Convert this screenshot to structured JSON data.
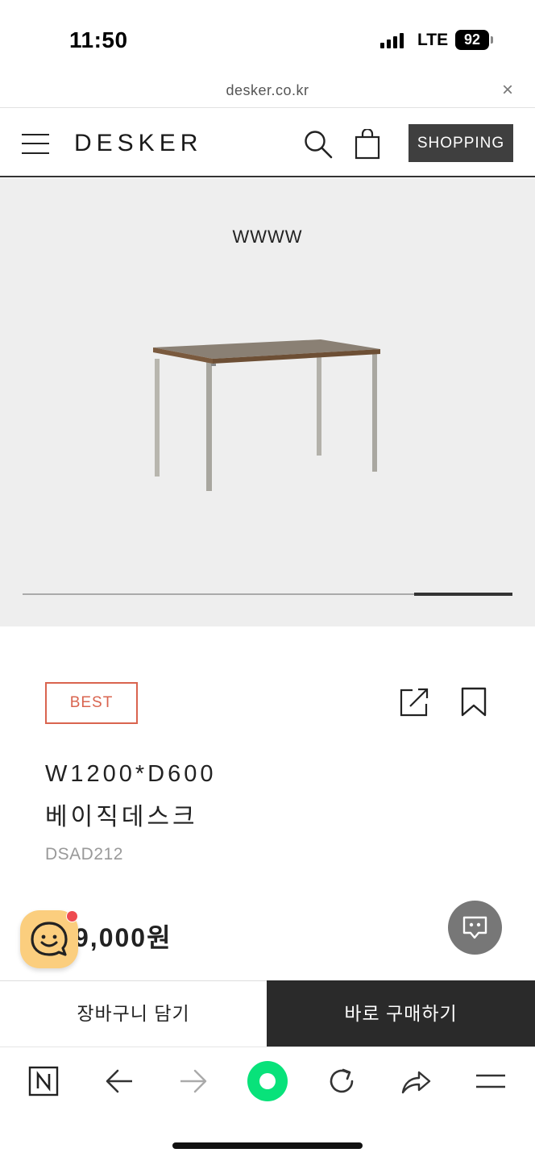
{
  "status_bar": {
    "time": "11:50",
    "network": "LTE",
    "battery": "92"
  },
  "browser": {
    "url": "desker.co.kr",
    "close_glyph": "×"
  },
  "header": {
    "logo": "DESKER",
    "shopping_label": "SHOPPING"
  },
  "hero": {
    "caption": "WWWW",
    "carousel_progress": {
      "start": 0.8,
      "end": 1.0
    }
  },
  "product": {
    "badge": "BEST",
    "name_line1": "W1200*D600",
    "name_line2": "베이직데스크",
    "code": "DSAD212",
    "price": "9,000원"
  },
  "actions": {
    "cart_label": "장바구니 담기",
    "buy_label": "바로 구매하기"
  },
  "icons": [
    "menu-icon",
    "search-icon",
    "bag-icon",
    "share-icon",
    "bookmark-icon",
    "talk-icon",
    "chat-icon",
    "naver-n-icon",
    "back-arrow-icon",
    "forward-arrow-icon",
    "green-dot-icon",
    "reload-icon",
    "share-arrow-icon",
    "hamburger-icon"
  ],
  "colors": {
    "badge": "#d9644f",
    "shopping_button": "#3f3f3f",
    "buy_button": "#2a2a2a",
    "hero_bg": "#eeeeee",
    "green": "#08e27a",
    "talk_bubble": "#fbce7e"
  }
}
